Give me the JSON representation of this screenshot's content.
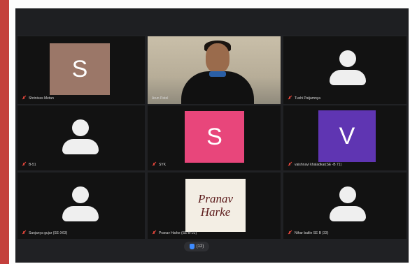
{
  "participants": [
    {
      "name": "Shrinivas Metan",
      "initial": "S",
      "avatar_color": "#9b7768"
    },
    {
      "name": "Arun Patel",
      "is_speaking": true
    },
    {
      "name": "Tushi Patjamnya"
    },
    {
      "name": "B-51"
    },
    {
      "name": "SYK",
      "initial": "S",
      "avatar_color": "#e8467b"
    },
    {
      "name": "vaishnavi khaladkar(SE -B 71)",
      "initial": "V",
      "avatar_color": "#5f35b2"
    },
    {
      "name": "Sanjanya gujar (SE-X63)"
    },
    {
      "name": "Pranav Harke (SE-B-22)",
      "image_text_line1": "Pranav",
      "image_text_line2": "Harke"
    },
    {
      "name": "Nihar batlie SE B (33)"
    }
  ],
  "hand_raise": {
    "count_label": "(12)"
  },
  "colors": {
    "mic_muted": "#e0453a",
    "speaking_outline": "#4caf50"
  }
}
